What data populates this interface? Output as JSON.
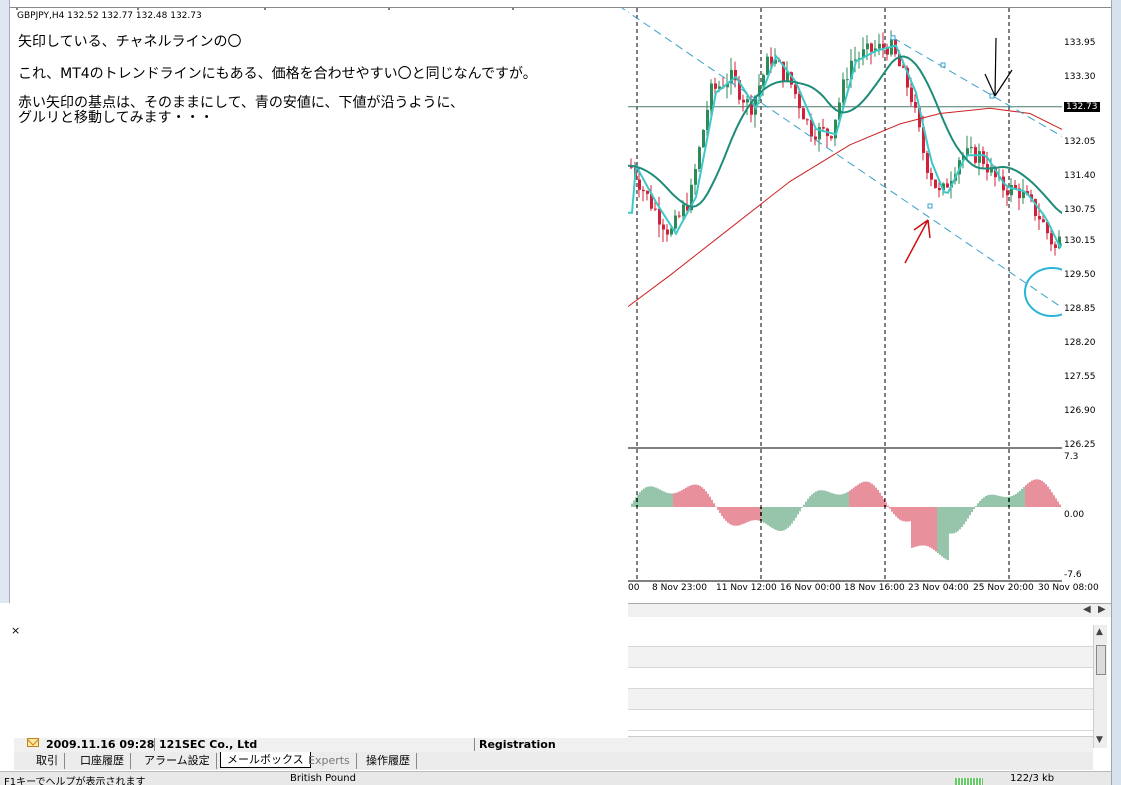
{
  "chart": {
    "header": "GBPJPY,H4  132.52 132.77 132.48 132.73",
    "current_price": "132.73",
    "price_labels": [
      "133.95",
      "133.30",
      "132.05",
      "131.40",
      "130.75",
      "130.15",
      "129.50",
      "128.85",
      "128.20",
      "127.55",
      "126.90",
      "126.25"
    ],
    "osc_labels": [
      "7.3",
      "0.00",
      "-7.6"
    ],
    "time_labels": [
      "00",
      "8 Nov 23:00",
      "11 Nov 12:00",
      "16 Nov 00:00",
      "18 Nov 16:00",
      "23 Nov 04:00",
      "25 Nov 20:00",
      "30 Nov 08:00"
    ],
    "colors": {
      "bull": "#2e8b57",
      "bear": "#d0203a",
      "fast_ma": "#3cc8c8",
      "slow_ma": "#1e8c78",
      "long_ma": "#cc2222",
      "channel": "#3aa0c8",
      "annotation_red": "#cc1111",
      "annotation_circle": "#2ab4d8"
    }
  },
  "notes": {
    "line1": "矢印している、チャネルラインの〇",
    "line2": "これ、MT4のトレンドラインにもある、価格を合わせやすい〇と同じなんですが。",
    "line3": "赤い矢印の基点は、そのままにして、青の安値に、下値が沿うように、",
    "line4": "グルリと移動してみます・・・"
  },
  "terminal": {
    "close_glyph": "×",
    "mail_date": "2009.11.16 09:28",
    "mail_from": "121SEC Co., Ltd",
    "mail_subject": "Registration",
    "tabs": [
      "取引",
      "口座履歴",
      "アラーム設定",
      "メールボックス",
      "Experts",
      "操作履歴"
    ],
    "active_tab": "メールボックス"
  },
  "status_bar": {
    "help": "F1キーでヘルプが表示されます",
    "profile": "British Pound",
    "traffic": "122/3 kb"
  }
}
